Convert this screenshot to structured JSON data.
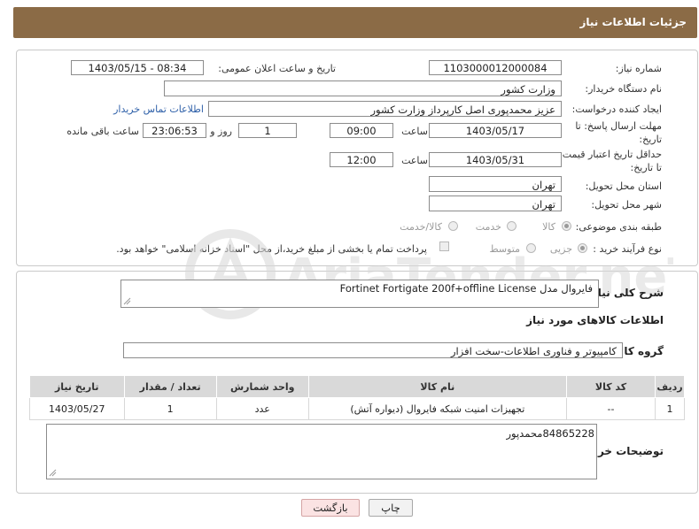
{
  "header": {
    "title": "جزئیات اطلاعات نیاز"
  },
  "form": {
    "need_number_label": "شماره نیاز:",
    "need_number": "1103000012000084",
    "announce_label": "تاریخ و ساعت اعلان عمومی:",
    "announce_value": "1403/05/15 - 08:34",
    "buyer_org_label": "نام دستگاه خریدار:",
    "buyer_org": "وزارت کشور",
    "creator_label": "ایجاد کننده درخواست:",
    "creator": "عزیز محمدپوری اصل کارپرداز وزارت کشور",
    "contact_link": "اطلاعات تماس خریدار",
    "reply_deadline_label": "مهلت ارسال پاسخ: تا تاریخ:",
    "reply_date": "1403/05/17",
    "time_label": "ساعت",
    "reply_time": "09:00",
    "days_value": "1",
    "days_label": "روز و",
    "remaining_time": "23:06:53",
    "remaining_label": "ساعت باقی مانده",
    "price_deadline_label": "حداقل تاریخ اعتبار قیمت: تا تاریخ:",
    "price_date": "1403/05/31",
    "price_time_label": "ساعت",
    "price_time": "12:00",
    "province_label": "استان محل تحویل:",
    "province": "تهران",
    "city_label": "شهر محل تحویل:",
    "city": "تهران",
    "category_label": "طبقه بندی موضوعی:",
    "category_options": [
      "کالا",
      "خدمت",
      "کالا/خدمت"
    ],
    "process_label": "نوع فرآیند خرید :",
    "process_options": [
      "جزیی",
      "متوسط"
    ],
    "payment_note": "پرداخت تمام یا بخشی از مبلغ خرید،از محل \"اسناد خزانه اسلامی\" خواهد بود."
  },
  "details": {
    "description_label": "شرح کلی نیاز:",
    "description": "فایروال مدل Fortinet Fortigate 200f+offline License",
    "goods_info_title": "اطلاعات کالاهای مورد نیاز",
    "goods_group_label": "گروه کالا:",
    "goods_group": "کامپیوتر و فناوری اطلاعات-سخت افزار",
    "table": {
      "headers": [
        "ردیف",
        "کد کالا",
        "نام کالا",
        "واحد شمارش",
        "تعداد / مقدار",
        "تاریخ نیاز"
      ],
      "rows": [
        [
          "1",
          "--",
          "تجهیزات امنیت شبکه فایروال (دیواره آتش)",
          "عدد",
          "1",
          "1403/05/27"
        ]
      ]
    },
    "buyer_notes_label": "توضیحات خریدار:",
    "buyer_notes": "84865228محمدپور"
  },
  "buttons": {
    "print": "چاپ",
    "back": "بازگشت"
  },
  "watermark": {
    "text": "AriaTender.neT"
  }
}
